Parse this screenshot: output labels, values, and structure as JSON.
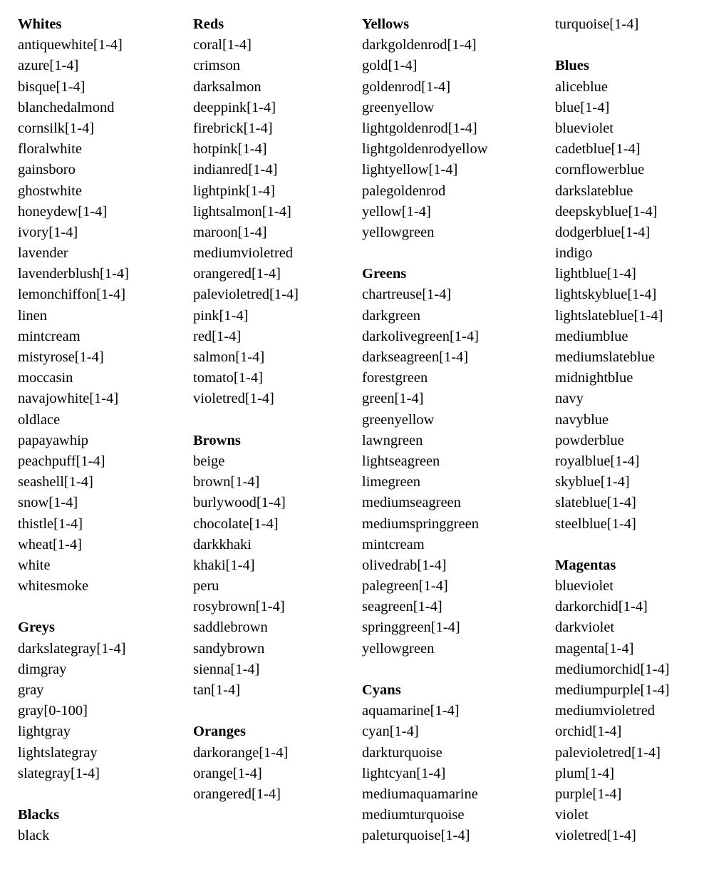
{
  "columns": [
    {
      "lines": [
        {
          "type": "header",
          "text": "Whites"
        },
        {
          "type": "item",
          "text": "antiquewhite[1-4]"
        },
        {
          "type": "item",
          "text": "azure[1-4]"
        },
        {
          "type": "item",
          "text": "bisque[1-4]"
        },
        {
          "type": "item",
          "text": "blanchedalmond"
        },
        {
          "type": "item",
          "text": "cornsilk[1-4]"
        },
        {
          "type": "item",
          "text": "floralwhite"
        },
        {
          "type": "item",
          "text": "gainsboro"
        },
        {
          "type": "item",
          "text": "ghostwhite"
        },
        {
          "type": "item",
          "text": "honeydew[1-4]"
        },
        {
          "type": "item",
          "text": "ivory[1-4]"
        },
        {
          "type": "item",
          "text": "lavender"
        },
        {
          "type": "item",
          "text": "lavenderblush[1-4]"
        },
        {
          "type": "item",
          "text": "lemonchiffon[1-4]"
        },
        {
          "type": "item",
          "text": "linen"
        },
        {
          "type": "item",
          "text": "mintcream"
        },
        {
          "type": "item",
          "text": "mistyrose[1-4]"
        },
        {
          "type": "item",
          "text": "moccasin"
        },
        {
          "type": "item",
          "text": "navajowhite[1-4]"
        },
        {
          "type": "item",
          "text": "oldlace"
        },
        {
          "type": "item",
          "text": "papayawhip"
        },
        {
          "type": "item",
          "text": "peachpuff[1-4]"
        },
        {
          "type": "item",
          "text": "seashell[1-4]"
        },
        {
          "type": "item",
          "text": "snow[1-4]"
        },
        {
          "type": "item",
          "text": "thistle[1-4]"
        },
        {
          "type": "item",
          "text": "wheat[1-4]"
        },
        {
          "type": "item",
          "text": "white"
        },
        {
          "type": "item",
          "text": "whitesmoke"
        },
        {
          "type": "blank",
          "text": ""
        },
        {
          "type": "header",
          "text": "Greys"
        },
        {
          "type": "item",
          "text": "darkslategray[1-4]"
        },
        {
          "type": "item",
          "text": "dimgray"
        },
        {
          "type": "item",
          "text": "gray"
        },
        {
          "type": "item",
          "text": "gray[0-100]"
        },
        {
          "type": "item",
          "text": "lightgray"
        },
        {
          "type": "item",
          "text": "lightslategray"
        },
        {
          "type": "item",
          "text": "slategray[1-4]"
        },
        {
          "type": "blank",
          "text": ""
        },
        {
          "type": "header",
          "text": "Blacks"
        },
        {
          "type": "item",
          "text": "black"
        }
      ]
    },
    {
      "lines": [
        {
          "type": "header",
          "text": "Reds"
        },
        {
          "type": "item",
          "text": "coral[1-4]"
        },
        {
          "type": "item",
          "text": "crimson"
        },
        {
          "type": "item",
          "text": "darksalmon"
        },
        {
          "type": "item",
          "text": "deeppink[1-4]"
        },
        {
          "type": "item",
          "text": "firebrick[1-4]"
        },
        {
          "type": "item",
          "text": "hotpink[1-4]"
        },
        {
          "type": "item",
          "text": "indianred[1-4]"
        },
        {
          "type": "item",
          "text": "lightpink[1-4]"
        },
        {
          "type": "item",
          "text": "lightsalmon[1-4]"
        },
        {
          "type": "item",
          "text": "maroon[1-4]"
        },
        {
          "type": "item",
          "text": "mediumvioletred"
        },
        {
          "type": "item",
          "text": "orangered[1-4]"
        },
        {
          "type": "item",
          "text": "palevioletred[1-4]"
        },
        {
          "type": "item",
          "text": "pink[1-4]"
        },
        {
          "type": "item",
          "text": "red[1-4]"
        },
        {
          "type": "item",
          "text": "salmon[1-4]"
        },
        {
          "type": "item",
          "text": "tomato[1-4]"
        },
        {
          "type": "item",
          "text": "violetred[1-4]"
        },
        {
          "type": "blank",
          "text": ""
        },
        {
          "type": "header",
          "text": "Browns"
        },
        {
          "type": "item",
          "text": "beige"
        },
        {
          "type": "item",
          "text": "brown[1-4]"
        },
        {
          "type": "item",
          "text": "burlywood[1-4]"
        },
        {
          "type": "item",
          "text": "chocolate[1-4]"
        },
        {
          "type": "item",
          "text": "darkkhaki"
        },
        {
          "type": "item",
          "text": "khaki[1-4]"
        },
        {
          "type": "item",
          "text": "peru"
        },
        {
          "type": "item",
          "text": "rosybrown[1-4]"
        },
        {
          "type": "item",
          "text": "saddlebrown"
        },
        {
          "type": "item",
          "text": "sandybrown"
        },
        {
          "type": "item",
          "text": "sienna[1-4]"
        },
        {
          "type": "item",
          "text": "tan[1-4]"
        },
        {
          "type": "blank",
          "text": ""
        },
        {
          "type": "header",
          "text": "Oranges"
        },
        {
          "type": "item",
          "text": "darkorange[1-4]"
        },
        {
          "type": "item",
          "text": "orange[1-4]"
        },
        {
          "type": "item",
          "text": "orangered[1-4]"
        }
      ]
    },
    {
      "lines": [
        {
          "type": "header",
          "text": "Yellows"
        },
        {
          "type": "item",
          "text": "darkgoldenrod[1-4]"
        },
        {
          "type": "item",
          "text": "gold[1-4]"
        },
        {
          "type": "item",
          "text": "goldenrod[1-4]"
        },
        {
          "type": "item",
          "text": "greenyellow"
        },
        {
          "type": "item",
          "text": "lightgoldenrod[1-4]"
        },
        {
          "type": "item",
          "text": "lightgoldenrodyellow"
        },
        {
          "type": "item",
          "text": "lightyellow[1-4]"
        },
        {
          "type": "item",
          "text": "palegoldenrod"
        },
        {
          "type": "item",
          "text": "yellow[1-4]"
        },
        {
          "type": "item",
          "text": "yellowgreen"
        },
        {
          "type": "blank",
          "text": ""
        },
        {
          "type": "header",
          "text": "Greens"
        },
        {
          "type": "item",
          "text": "chartreuse[1-4]"
        },
        {
          "type": "item",
          "text": "darkgreen"
        },
        {
          "type": "item",
          "text": "darkolivegreen[1-4]"
        },
        {
          "type": "item",
          "text": "darkseagreen[1-4]"
        },
        {
          "type": "item",
          "text": "forestgreen"
        },
        {
          "type": "item",
          "text": "green[1-4]"
        },
        {
          "type": "item",
          "text": "greenyellow"
        },
        {
          "type": "item",
          "text": "lawngreen"
        },
        {
          "type": "item",
          "text": "lightseagreen"
        },
        {
          "type": "item",
          "text": "limegreen"
        },
        {
          "type": "item",
          "text": "mediumseagreen"
        },
        {
          "type": "item",
          "text": "mediumspringgreen"
        },
        {
          "type": "item",
          "text": "mintcream"
        },
        {
          "type": "item",
          "text": "olivedrab[1-4]"
        },
        {
          "type": "item",
          "text": "palegreen[1-4]"
        },
        {
          "type": "item",
          "text": "seagreen[1-4]"
        },
        {
          "type": "item",
          "text": "springgreen[1-4]"
        },
        {
          "type": "item",
          "text": "yellowgreen"
        },
        {
          "type": "blank",
          "text": ""
        },
        {
          "type": "header",
          "text": "Cyans"
        },
        {
          "type": "item",
          "text": "aquamarine[1-4]"
        },
        {
          "type": "item",
          "text": "cyan[1-4]"
        },
        {
          "type": "item",
          "text": "darkturquoise"
        },
        {
          "type": "item",
          "text": "lightcyan[1-4]"
        },
        {
          "type": "item",
          "text": "mediumaquamarine"
        },
        {
          "type": "item",
          "text": "mediumturquoise"
        },
        {
          "type": "item",
          "text": "paleturquoise[1-4]"
        }
      ]
    },
    {
      "lines": [
        {
          "type": "item",
          "text": "turquoise[1-4]"
        },
        {
          "type": "blank",
          "text": ""
        },
        {
          "type": "header",
          "text": "Blues"
        },
        {
          "type": "item",
          "text": "aliceblue"
        },
        {
          "type": "item",
          "text": "blue[1-4]"
        },
        {
          "type": "item",
          "text": "blueviolet"
        },
        {
          "type": "item",
          "text": "cadetblue[1-4]"
        },
        {
          "type": "item",
          "text": "cornflowerblue"
        },
        {
          "type": "item",
          "text": "darkslateblue"
        },
        {
          "type": "item",
          "text": "deepskyblue[1-4]"
        },
        {
          "type": "item",
          "text": "dodgerblue[1-4]"
        },
        {
          "type": "item",
          "text": "indigo"
        },
        {
          "type": "item",
          "text": "lightblue[1-4]"
        },
        {
          "type": "item",
          "text": "lightskyblue[1-4]"
        },
        {
          "type": "item",
          "text": "lightslateblue[1-4]"
        },
        {
          "type": "item",
          "text": "mediumblue"
        },
        {
          "type": "item",
          "text": "mediumslateblue"
        },
        {
          "type": "item",
          "text": "midnightblue"
        },
        {
          "type": "item",
          "text": "navy"
        },
        {
          "type": "item",
          "text": "navyblue"
        },
        {
          "type": "item",
          "text": "powderblue"
        },
        {
          "type": "item",
          "text": "royalblue[1-4]"
        },
        {
          "type": "item",
          "text": "skyblue[1-4]"
        },
        {
          "type": "item",
          "text": "slateblue[1-4]"
        },
        {
          "type": "item",
          "text": "steelblue[1-4]"
        },
        {
          "type": "blank",
          "text": ""
        },
        {
          "type": "header",
          "text": "Magentas"
        },
        {
          "type": "item",
          "text": "blueviolet"
        },
        {
          "type": "item",
          "text": "darkorchid[1-4]"
        },
        {
          "type": "item",
          "text": "darkviolet"
        },
        {
          "type": "item",
          "text": "magenta[1-4]"
        },
        {
          "type": "item",
          "text": "mediumorchid[1-4]"
        },
        {
          "type": "item",
          "text": "mediumpurple[1-4]"
        },
        {
          "type": "item",
          "text": "mediumvioletred"
        },
        {
          "type": "item",
          "text": "orchid[1-4]"
        },
        {
          "type": "item",
          "text": "palevioletred[1-4]"
        },
        {
          "type": "item",
          "text": "plum[1-4]"
        },
        {
          "type": "item",
          "text": "purple[1-4]"
        },
        {
          "type": "item",
          "text": "violet"
        },
        {
          "type": "item",
          "text": "violetred[1-4]"
        }
      ]
    }
  ]
}
